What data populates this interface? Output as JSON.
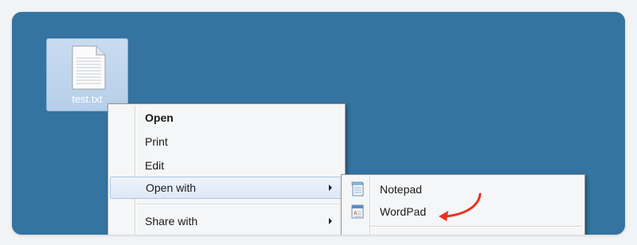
{
  "desktop": {
    "file": {
      "name": "test.txt",
      "icon": "text-file-icon"
    }
  },
  "context_menu": {
    "items": [
      {
        "label": "Open",
        "bold": true
      },
      {
        "label": "Print"
      },
      {
        "label": "Edit"
      },
      {
        "label": "Open with",
        "submenu": true,
        "highlighted": true
      },
      {
        "label": "Share with",
        "submenu": true
      }
    ]
  },
  "open_with_menu": {
    "items": [
      {
        "label": "Notepad",
        "icon": "notepad-icon"
      },
      {
        "label": "WordPad",
        "icon": "wordpad-icon"
      }
    ]
  },
  "annotation": {
    "icon": "red-arrow-icon",
    "color": "#e8321e",
    "points_to": "WordPad"
  },
  "colors": {
    "desktop": "#3573a0",
    "menu": "#f5f6f7",
    "highlight": "#dde9f7"
  }
}
